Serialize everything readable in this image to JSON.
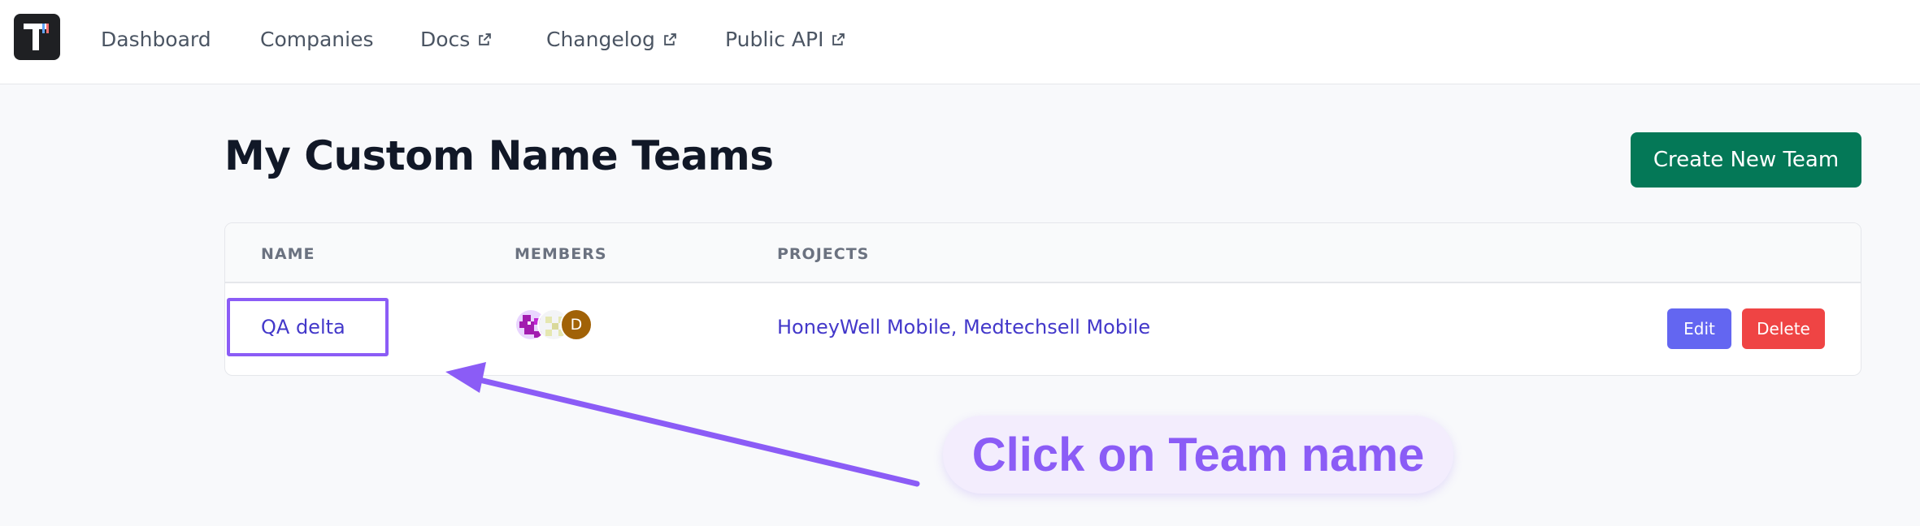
{
  "nav": {
    "items": [
      {
        "label": "Dashboard",
        "external": false
      },
      {
        "label": "Companies",
        "external": false
      },
      {
        "label": "Docs",
        "external": true
      },
      {
        "label": "Changelog",
        "external": true
      },
      {
        "label": "Public API",
        "external": true
      }
    ]
  },
  "page": {
    "title": "My Custom Name Teams",
    "create_button": "Create New Team"
  },
  "table": {
    "headers": [
      "NAME",
      "MEMBERS",
      "PROJECTS"
    ],
    "rows": [
      {
        "name": "QA delta",
        "members": [
          {
            "initial": "",
            "avatar": "pixel-avatar-purple"
          },
          {
            "initial": "",
            "avatar": "pixel-avatar-light"
          },
          {
            "initial": "D",
            "avatar": "initial-avatar"
          }
        ],
        "projects": "HoneyWell Mobile, Medtechsell Mobile",
        "edit_label": "Edit",
        "delete_label": "Delete"
      }
    ]
  },
  "annotation": {
    "callout": "Click on Team name"
  },
  "colors": {
    "primary_green": "#047857",
    "link": "#4338ca",
    "edit": "#6366f1",
    "delete": "#ef4444",
    "annotation": "#8b5cf6"
  }
}
